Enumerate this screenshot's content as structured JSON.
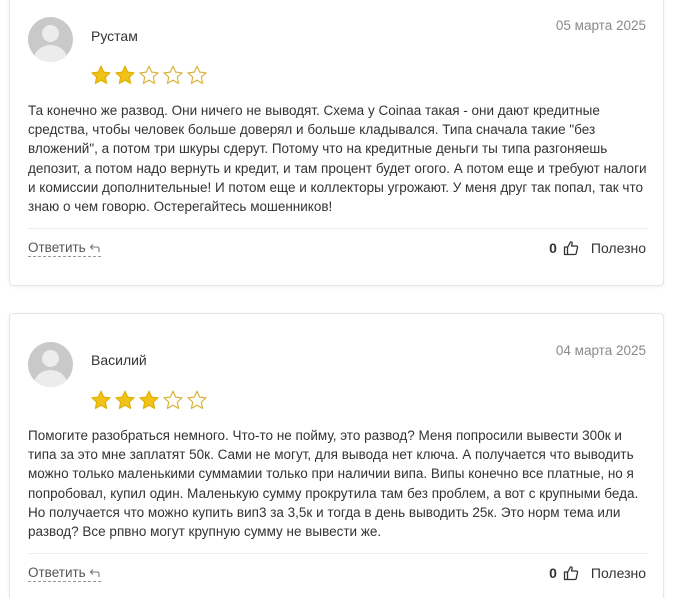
{
  "reviews": [
    {
      "author": "Рустам",
      "date": "05 марта 2025",
      "rating": 2,
      "max_rating": 5,
      "text": "Та конечно же развод. Они ничего не выводят. Схема у Coinaa такая - они дают кредитные средства, чтобы человек больше доверял и больше кладывался. Типа сначала такие \"без вложений\", а потом три шкуры сдерут. Потому что на кредитные деньги ты типа разгоняешь депозит, а потом надо вернуть и кредит, и там процент будет огого. А потом еще и требуют налоги и комиссии дополнительные! И потом еще и коллекторы угрожают. У меня друг так попал, так что знаю о чем говорю. Остерегайтесь мошенников!",
      "reply_label": "Ответить",
      "likes": "0",
      "useful_label": "Полезно"
    },
    {
      "author": "Василий",
      "date": "04 марта 2025",
      "rating": 3,
      "max_rating": 5,
      "text": "Помогите разобраться немного. Что-то не пойму, это развод? Меня попросили вывести 300к и типа за это мне заплатят 50к. Сами не могут, для вывода нет ключа. А получается что выводить можно только маленькими суммамии только при наличии випа. Випы конечно все платные, но я попробовал, купил один. Маленькую сумму прокрутила там без проблем, а вот с крупными беда. Но получается что можно купить вип3 за 3,5к и тогда в день выводить 25к. Это норм тема или развод? Все рпвно могут крупную сумму не вывести же.",
      "reply_label": "Ответить",
      "likes": "0",
      "useful_label": "Полезно"
    }
  ],
  "colors": {
    "star_filled": "#f1c31a",
    "star_empty_stroke": "#d8b33a",
    "date_text": "#8a8a8a",
    "card_border": "#e6e6e6"
  },
  "icons": {
    "star": "star-icon",
    "reply": "reply-arrow-icon",
    "thumb": "thumbs-up-icon",
    "avatar": "user-avatar-icon"
  }
}
